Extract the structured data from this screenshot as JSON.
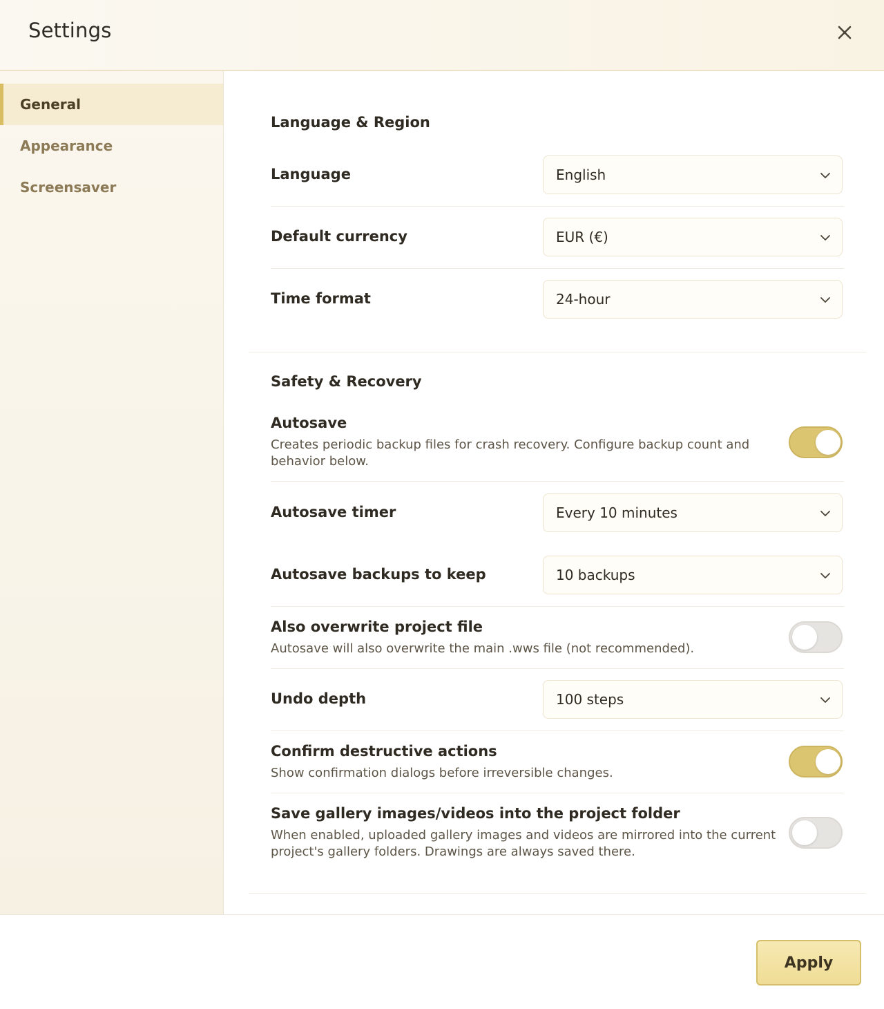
{
  "window": {
    "title": "Settings",
    "close_icon": "close-icon"
  },
  "sidebar": {
    "items": [
      {
        "label": "General",
        "active": true
      },
      {
        "label": "Appearance",
        "active": false
      },
      {
        "label": "Screensaver",
        "active": false
      }
    ]
  },
  "language_region": {
    "title": "Language & Region",
    "language": {
      "label": "Language",
      "value": "English"
    },
    "currency": {
      "label": "Default currency",
      "value": "EUR (€)"
    },
    "time_format": {
      "label": "Time format",
      "value": "24-hour"
    }
  },
  "safety": {
    "title": "Safety & Recovery",
    "autosave": {
      "label": "Autosave",
      "description": "Creates periodic backup files for crash recovery. Configure backup count and behavior below.",
      "enabled": true
    },
    "autosave_timer": {
      "label": "Autosave timer",
      "value": "Every 10 minutes"
    },
    "autosave_backups": {
      "label": "Autosave backups to keep",
      "value": "10 backups"
    },
    "overwrite_project": {
      "label": "Also overwrite project file",
      "description": "Autosave will also overwrite the main .wws file (not recommended).",
      "enabled": false
    },
    "undo_depth": {
      "label": "Undo depth",
      "value": "100 steps"
    },
    "confirm_destructive": {
      "label": "Confirm destructive actions",
      "description": "Show confirmation dialogs before irreversible changes.",
      "enabled": true
    },
    "save_gallery": {
      "label": "Save gallery images/videos into the project folder",
      "description": "When enabled, uploaded gallery images and videos are mirrored into the current project's gallery folders. Drawings are always saved there.",
      "enabled": false
    }
  },
  "footer": {
    "apply_label": "Apply"
  },
  "colors": {
    "accent": "#dcc571",
    "accent_border": "#d5bf6b",
    "sidebar_active": "#f6ecd2"
  }
}
